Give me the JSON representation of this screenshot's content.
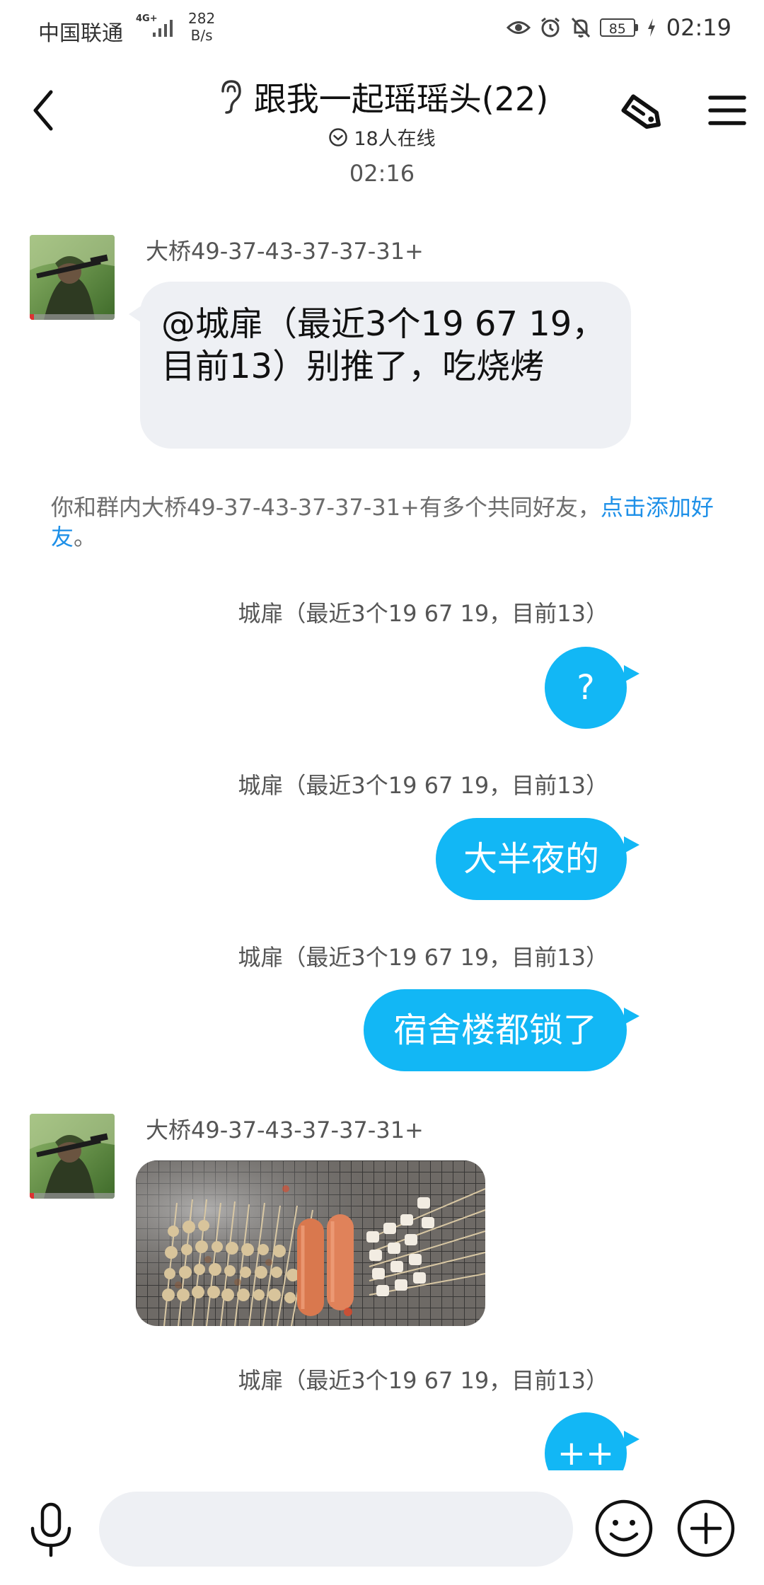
{
  "status_bar": {
    "carrier": "中国联通",
    "network": "4G+",
    "speed_value": "282",
    "speed_unit": "B/s",
    "battery": "85",
    "time": "02:19",
    "icons": [
      "eye-icon",
      "alarm-icon",
      "mute-bell-icon",
      "battery-icon",
      "charging-icon",
      "signal-icon"
    ]
  },
  "header": {
    "title": "跟我一起瑶瑶头(22)",
    "online": "18人在线",
    "icons": [
      "back-arrow-icon",
      "ear-icon",
      "check-circle-icon",
      "share-tag-icon",
      "menu-icon"
    ]
  },
  "chat": {
    "timestamp": "02:16",
    "other_sender": "大桥49-37-43-37-37-31+",
    "self_sender": "城扉（最近3个19 67 19，目前13）",
    "incoming_text": "@城扉（最近3个19 67 19，目前13）别推了，吃烧烤",
    "notice_text": "你和群内大桥49-37-43-37-37-31+有多个共同好友，",
    "notice_link": "点击添加好友",
    "notice_end": "。",
    "outgoing": [
      {
        "text": "?"
      },
      {
        "text": "大半夜的"
      },
      {
        "text": "宿舍楼都锁了"
      },
      {
        "text": "++"
      }
    ],
    "image_content": "bbq-skewers-photo"
  },
  "input_bar": {
    "placeholder": "",
    "icons": [
      "microphone-icon",
      "emoji-icon",
      "plus-icon"
    ]
  },
  "colors": {
    "accent": "#12b7f5",
    "incoming_bubble": "#eef0f4",
    "link": "#1e90e8"
  }
}
